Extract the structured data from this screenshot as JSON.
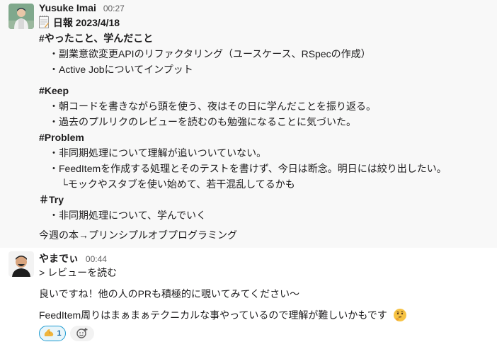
{
  "message1": {
    "author": "Yusuke Imai",
    "time": "00:27",
    "title": "日報 2023/4/18",
    "lines": [
      "#やったこと、学んだこと",
      "・副業意欲変更APIのリファクタリング（ユースケース、RSpecの作成）",
      "・Active Jobについてインプット",
      "#Keep",
      "・朝コードを書きながら頭を使う、夜はその日に学んだことを振り返る。",
      "・過去のプルリクのレビューを読むのも勉強になることに気づいた。",
      "#Problem",
      "・非同期処理について理解が追いついていない。",
      "・FeedItemを作成する処理とそのテストを書けず、今日は断念。明日には絞り出したい。",
      "└モックやスタブを使い始めて、若干混乱してるかも",
      "＃Try",
      "・非同期処理について、学んでいく",
      "今週の本→プリンシプルオブプログラミング"
    ]
  },
  "message2": {
    "author": "やまでぃ",
    "time": "00:44",
    "lines": [
      "> レビューを読む",
      "良いですね！他の人のPRも積極的に覗いてみてください〜",
      "FeedItem周りはまぁまぁテクニカルな事やっているので理解が難しいかもです"
    ],
    "reaction": {
      "emoji": "muscle-emoji",
      "count": "1"
    },
    "add_reaction_icon": "add-reaction-icon"
  },
  "colors": {
    "highlight_bg": "#f8f8f8",
    "reaction_border": "#1d9bd1",
    "reaction_text": "#1264a3",
    "time_text": "#616061"
  }
}
